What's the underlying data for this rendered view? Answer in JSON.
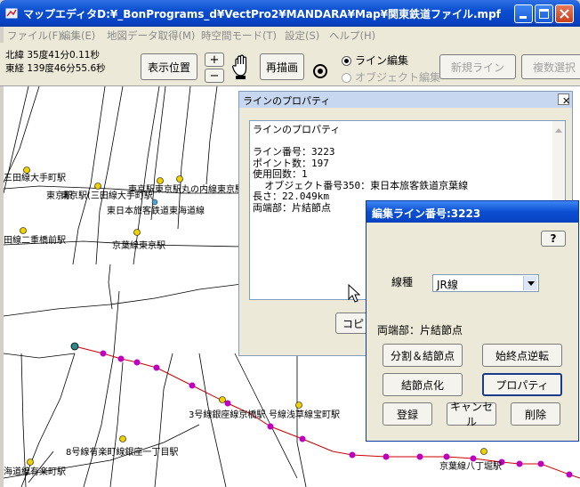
{
  "window": {
    "title": "マップエディタD:¥_BonPrograms_d¥VectPro2¥MANDARA¥Map¥関東鉄道ファイル.mpf"
  },
  "menu": [
    "ファイル(F)",
    "編集(E)",
    "地図データ取得(M)",
    "時空間モード(T)",
    "設定(S)",
    "ヘルプ(H)"
  ],
  "coords": {
    "lat": "北緯 35度41分0.11秒",
    "lon": "東経 139度46分55.6秒"
  },
  "toolbar": {
    "show_position": "表示位置",
    "zoom_in": "+",
    "zoom_out": "−",
    "redraw": "再描画",
    "line_edit": "ライン編集",
    "object_edit": "オブジェクト編集",
    "new_line": "新規ライン",
    "multi_select": "複数選択"
  },
  "map_labels": [
    "三田線大手町駅",
    "東京駅",
    "東京駅(三田線大手町駅",
    "東京駅東京駅丸の内線東京駅",
    "東日本旅客鉄道東海道線",
    "田線二重橋前駅",
    "京葉線東京駅",
    "3号線銀座線京橋駅",
    "号線浅草線宝町駅",
    "8号線有楽町線銀座一丁目駅",
    "海道線有楽町駅",
    "京葉線八丁堀駅"
  ],
  "properties": {
    "title": "ラインのプロパティ",
    "text": "ラインのプロパティ\n\nライン番号：3223\nポイント数：197\n使用回数：1\n  オブジェクト番号350：東日本旅客鉄道京葉線\n長さ：22.049km\n両端部：片結節点",
    "copy_button": "コピ"
  },
  "edit_window": {
    "title": "編集ライン番号:3223",
    "help": "?",
    "line_type_label": "線種",
    "line_type_value": "JR線",
    "both_ends": "両端部：片結節点",
    "split_node": "分割＆結節点",
    "reverse_ends": "始終点逆転",
    "make_node": "結節点化",
    "property": "プロパティ",
    "register": "登録",
    "cancel": "キャンセル",
    "delete": "削除"
  }
}
